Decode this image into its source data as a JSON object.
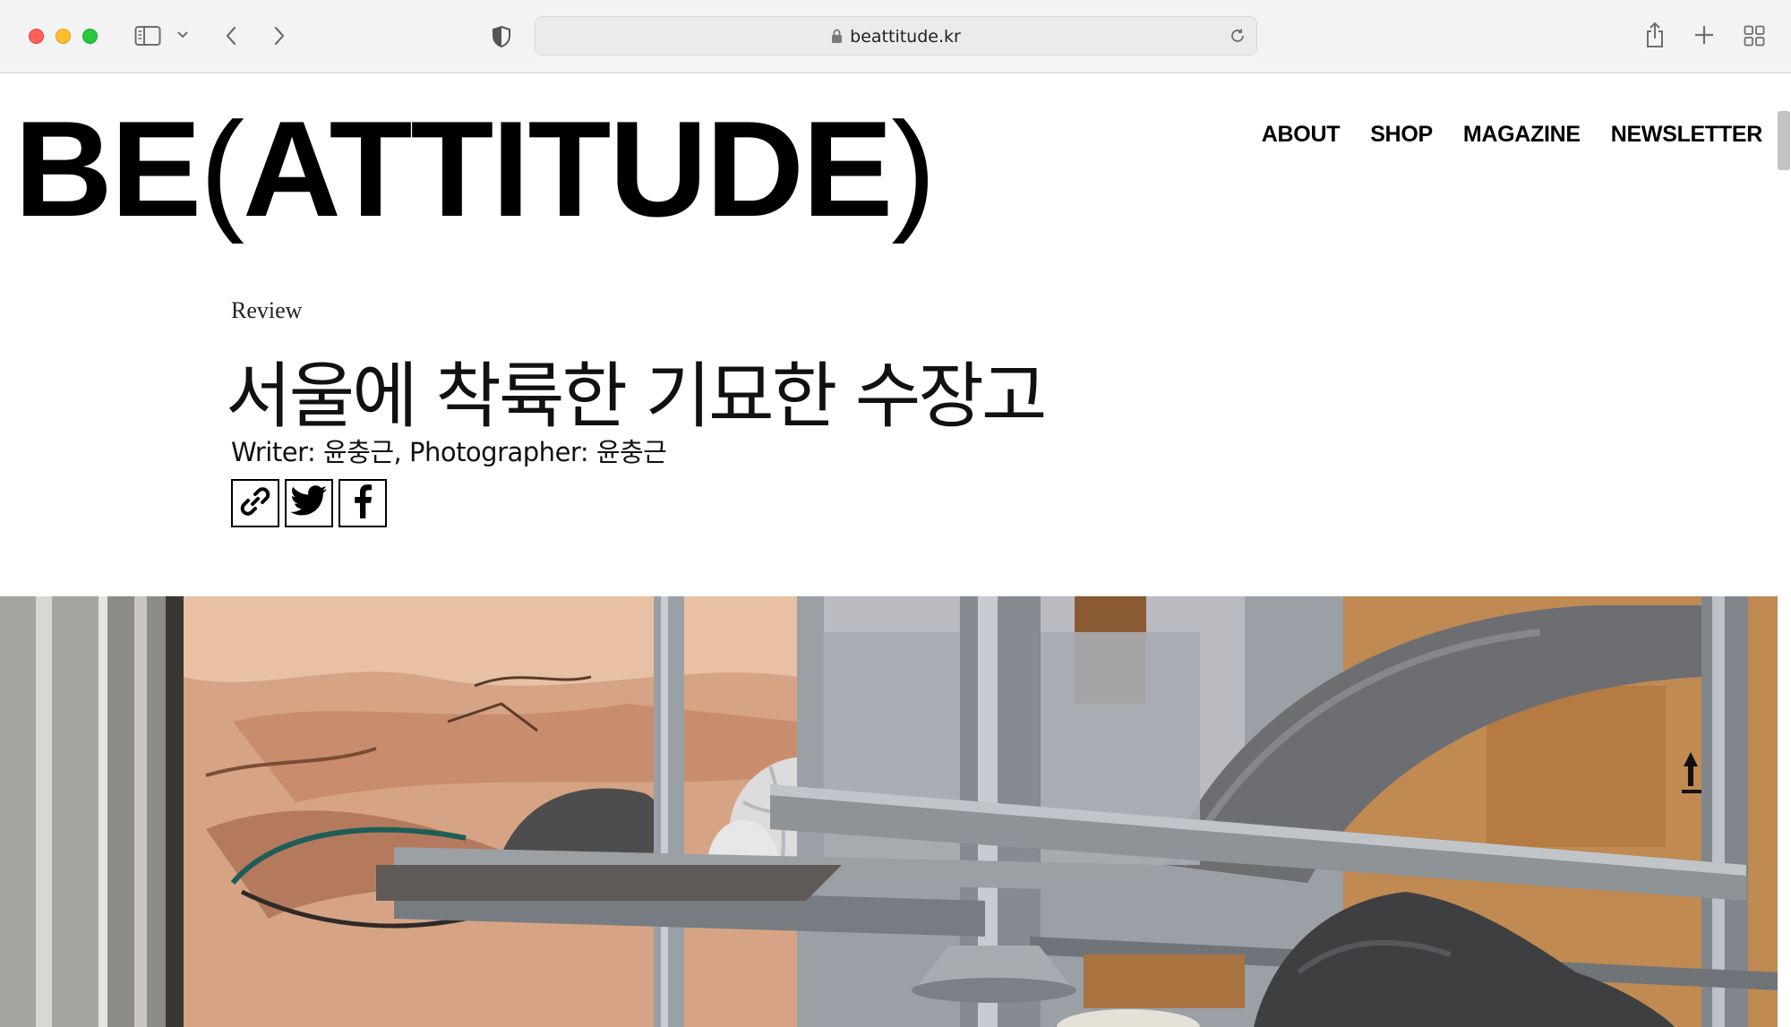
{
  "browser": {
    "url": "beattitude.kr",
    "icons": [
      "sidebar-icon",
      "chevron-down-icon",
      "back-icon",
      "forward-icon",
      "shield-icon",
      "lock-icon",
      "reload-icon",
      "share-icon",
      "new-tab-icon",
      "tab-overview-icon"
    ]
  },
  "site": {
    "logo_left": "BE",
    "logo_open_paren": "(",
    "logo_main": "ATTITUDE",
    "logo_close_paren": ")",
    "nav": [
      "ABOUT",
      "SHOP",
      "MAGAZINE",
      "NEWSLETTER"
    ]
  },
  "article": {
    "category": "Review",
    "title": "서울에 착륙한 기묘한 수장고",
    "byline_writer_label": "Writer: ",
    "byline_writer": "윤충근",
    "byline_separator": ", ",
    "byline_photographer_label": "Photographer: ",
    "byline_photographer": "윤충근",
    "share_icons": [
      "link-icon",
      "twitter-icon",
      "facebook-icon"
    ]
  },
  "colors": {
    "traffic_red": "#fe5f57",
    "traffic_yellow": "#febc2e",
    "traffic_green": "#28c840",
    "text": "#000000"
  }
}
